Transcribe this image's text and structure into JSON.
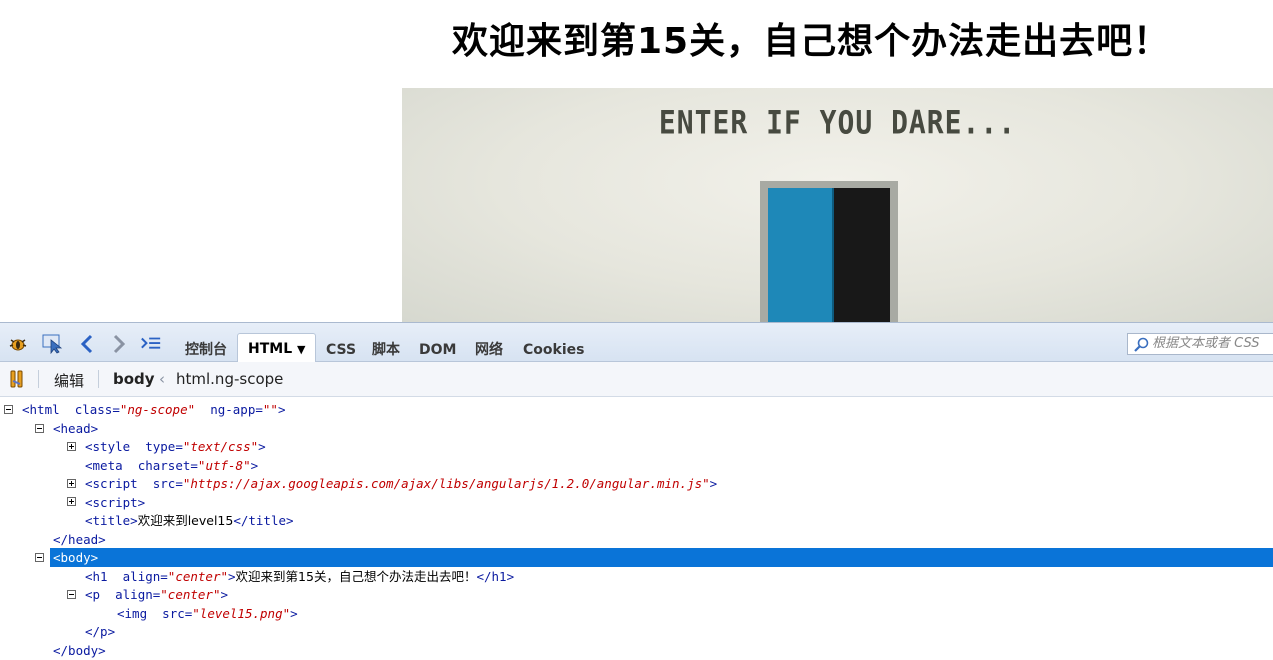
{
  "page": {
    "heading": "欢迎来到第15关，自己想个办法走出去吧！",
    "image_caption": "ENTER IF YOU DARE..."
  },
  "devtools": {
    "tabs": [
      "控制台",
      "HTML",
      "CSS",
      "脚本",
      "DOM",
      "网络",
      "Cookies"
    ],
    "active_tab": "HTML",
    "search_placeholder": "根据文本或者 CSS 选择器搜索",
    "search_visible": "根据文本或者 CSS",
    "edit_label": "编辑",
    "breadcrumb": {
      "current": "body",
      "separator": "‹",
      "parent": "html.ng-scope"
    },
    "icons": [
      "firebug-icon",
      "inspect-icon",
      "back-arrow-icon",
      "forward-arrow-icon",
      "command-line-icon",
      "search-icon",
      "break-on-mutation-icon"
    ],
    "tree": {
      "html_open": {
        "tag": "<html",
        "attr1": "class=",
        "val1": "\"ng-scope\"",
        "attr2": "ng-app=",
        "val2": "\"\"",
        "close": ">"
      },
      "head_open": "<head>",
      "style": {
        "tag": "<style",
        "attr": "type=",
        "val": "\"text/css\"",
        "close": ">"
      },
      "meta": {
        "tag": "<meta",
        "attr": "charset=",
        "val": "\"utf-8\"",
        "close": ">"
      },
      "script1": {
        "tag": "<script",
        "attr": "src=",
        "val": "\"https://ajax.googleapis.com/ajax/libs/angularjs/1.2.0/angular.min.js\"",
        "close": ">"
      },
      "script2": "<script>",
      "title": {
        "open": "<title>",
        "text": "欢迎来到level15",
        "close": "</title>"
      },
      "head_close": "</head>",
      "body_open": "<body>",
      "h1": {
        "tag": "<h1",
        "attr": "align=",
        "val": "\"center\"",
        "close": ">",
        "text": "欢迎来到第15关，自己想个办法走出去吧！",
        "end": "</h1>"
      },
      "p_open": {
        "tag": "<p",
        "attr": "align=",
        "val": "\"center\"",
        "close": ">"
      },
      "img": {
        "tag": "<img",
        "attr": "src=",
        "val": "\"level15.png\"",
        "close": ">"
      },
      "p_close": "</p>",
      "body_close": "</body>"
    }
  },
  "colors": {
    "selection": "#0a74d8",
    "tag": "#0a1aa0",
    "attr_value": "#c00000",
    "door": "#1e88b8"
  }
}
